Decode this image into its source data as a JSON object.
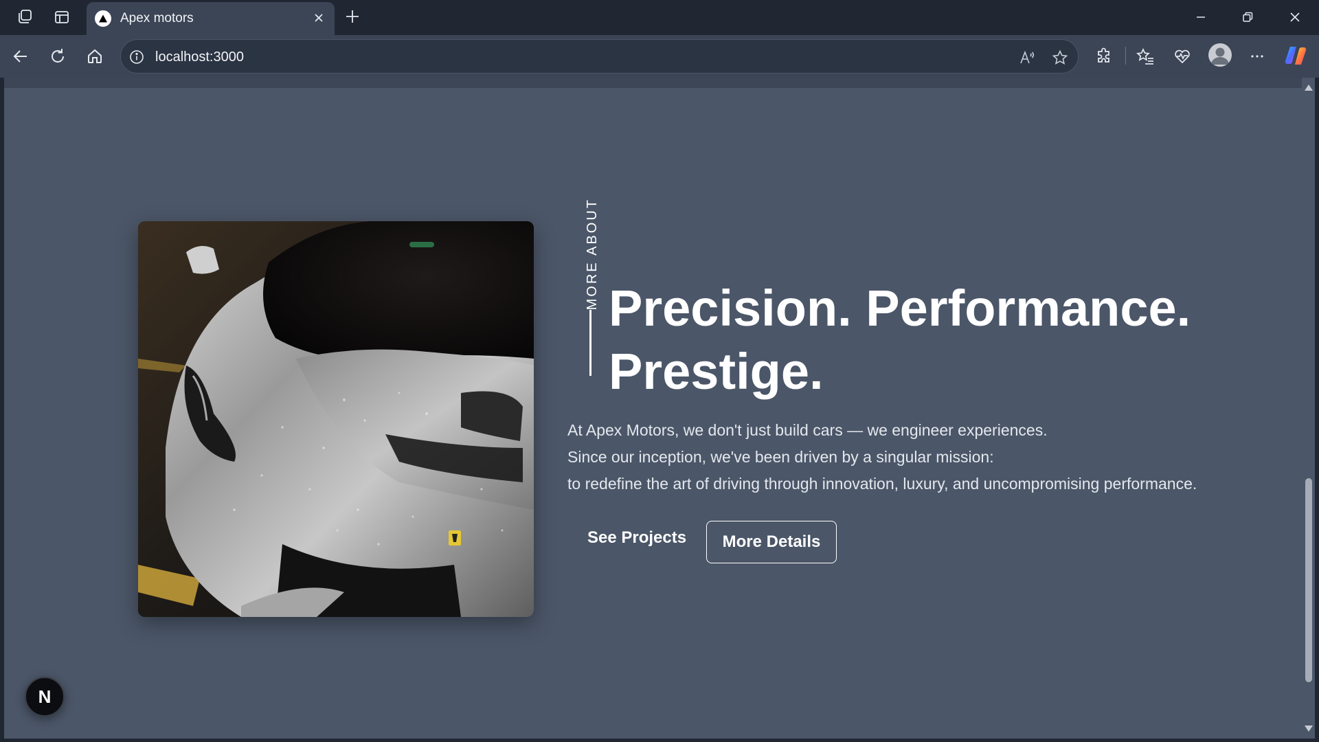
{
  "browser": {
    "tab_title": "Apex motors",
    "url": "localhost:3000"
  },
  "hero": {
    "vertical_label": "MORE ABOUT",
    "headline_line1": "Precision. Performance.",
    "headline_line2": "Prestige.",
    "description_line1": "At Apex Motors, we don't just build cars — we engineer experiences.",
    "description_line2": "Since our inception, we've been driven by a singular mission:",
    "description_line3": "to redefine the art of driving through innovation, luxury, and uncompromising performance.",
    "primary_button": "See Projects",
    "secondary_button": "More Details"
  },
  "dev_badge": "N"
}
